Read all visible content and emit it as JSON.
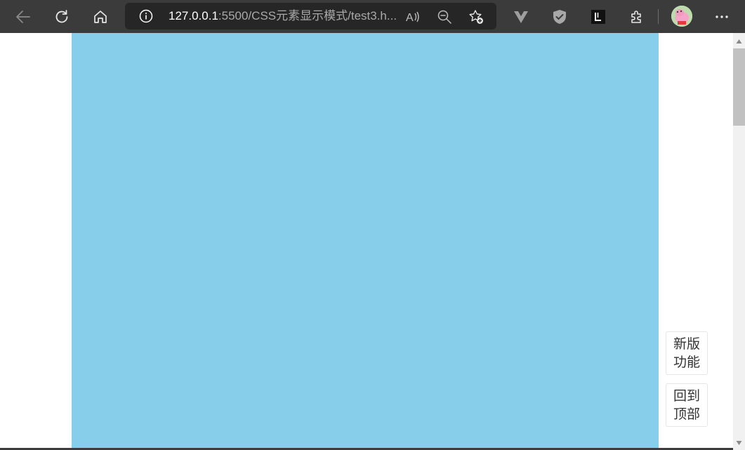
{
  "browser": {
    "url_host": "127.0.0.1",
    "url_rest": ":5500/CSS元素显示模式/test3.h..."
  },
  "page": {
    "background_color": "#87ceeb",
    "side_buttons": {
      "new_features": {
        "line1": "新版",
        "line2": "功能"
      },
      "back_to_top": {
        "line1": "回到",
        "line2": "顶部"
      }
    }
  },
  "icons": {
    "back": "arrow-left-icon",
    "refresh": "refresh-icon",
    "home": "home-icon",
    "site_info": "info-icon",
    "read_aloud": "read-aloud-icon",
    "zoom": "zoom-out-icon",
    "favorite": "add-favorite-icon",
    "ext1": "vue-devtools-icon",
    "ext2": "shield-icon",
    "ext3": "letter-l-extension-icon",
    "extensions": "puzzle-icon",
    "profile": "avatar",
    "menu": "more-dots-icon"
  }
}
